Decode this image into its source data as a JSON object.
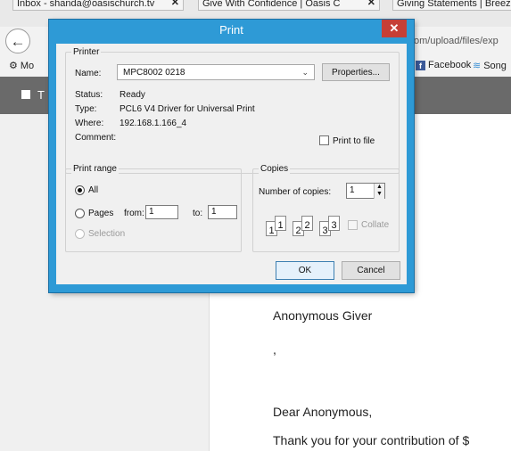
{
  "browser": {
    "tabs": [
      {
        "title": "Inbox - shanda@oasischurch.tv",
        "close": "✕"
      },
      {
        "title": "Give With Confidence | Oasis C",
        "close": "✕"
      },
      {
        "title": "Giving Statements | Breeze"
      }
    ],
    "url_fragment": "om/upload/files/exp",
    "bookmarks": {
      "partial": "Mo",
      "facebook": "Facebook",
      "songs": "Song"
    }
  },
  "page": {
    "menu_label": "T",
    "lines": [
      "Anonymous Giver",
      ",",
      "Dear Anonymous,",
      "Thank you for your contribution of $"
    ]
  },
  "dialog": {
    "title": "Print",
    "close": "✕",
    "printer": {
      "group_label": "Printer",
      "name_label": "Name:",
      "name_value": "MPC8002 0218",
      "properties": "Properties...",
      "status_label": "Status:",
      "status_value": "Ready",
      "type_label": "Type:",
      "type_value": "PCL6 V4 Driver for Universal Print",
      "where_label": "Where:",
      "where_value": "192.168.1.166_4",
      "comment_label": "Comment:",
      "print_to_file": "Print to file"
    },
    "range": {
      "group_label": "Print range",
      "all": "All",
      "pages": "Pages",
      "from_label": "from:",
      "from_value": "1",
      "to_label": "to:",
      "to_value": "1",
      "selection": "Selection"
    },
    "copies": {
      "group_label": "Copies",
      "number_label": "Number of copies:",
      "number_value": "1",
      "collate": "Collate",
      "page_numbers": [
        "1",
        "1",
        "2",
        "2",
        "3",
        "3"
      ]
    },
    "ok": "OK",
    "cancel": "Cancel"
  }
}
